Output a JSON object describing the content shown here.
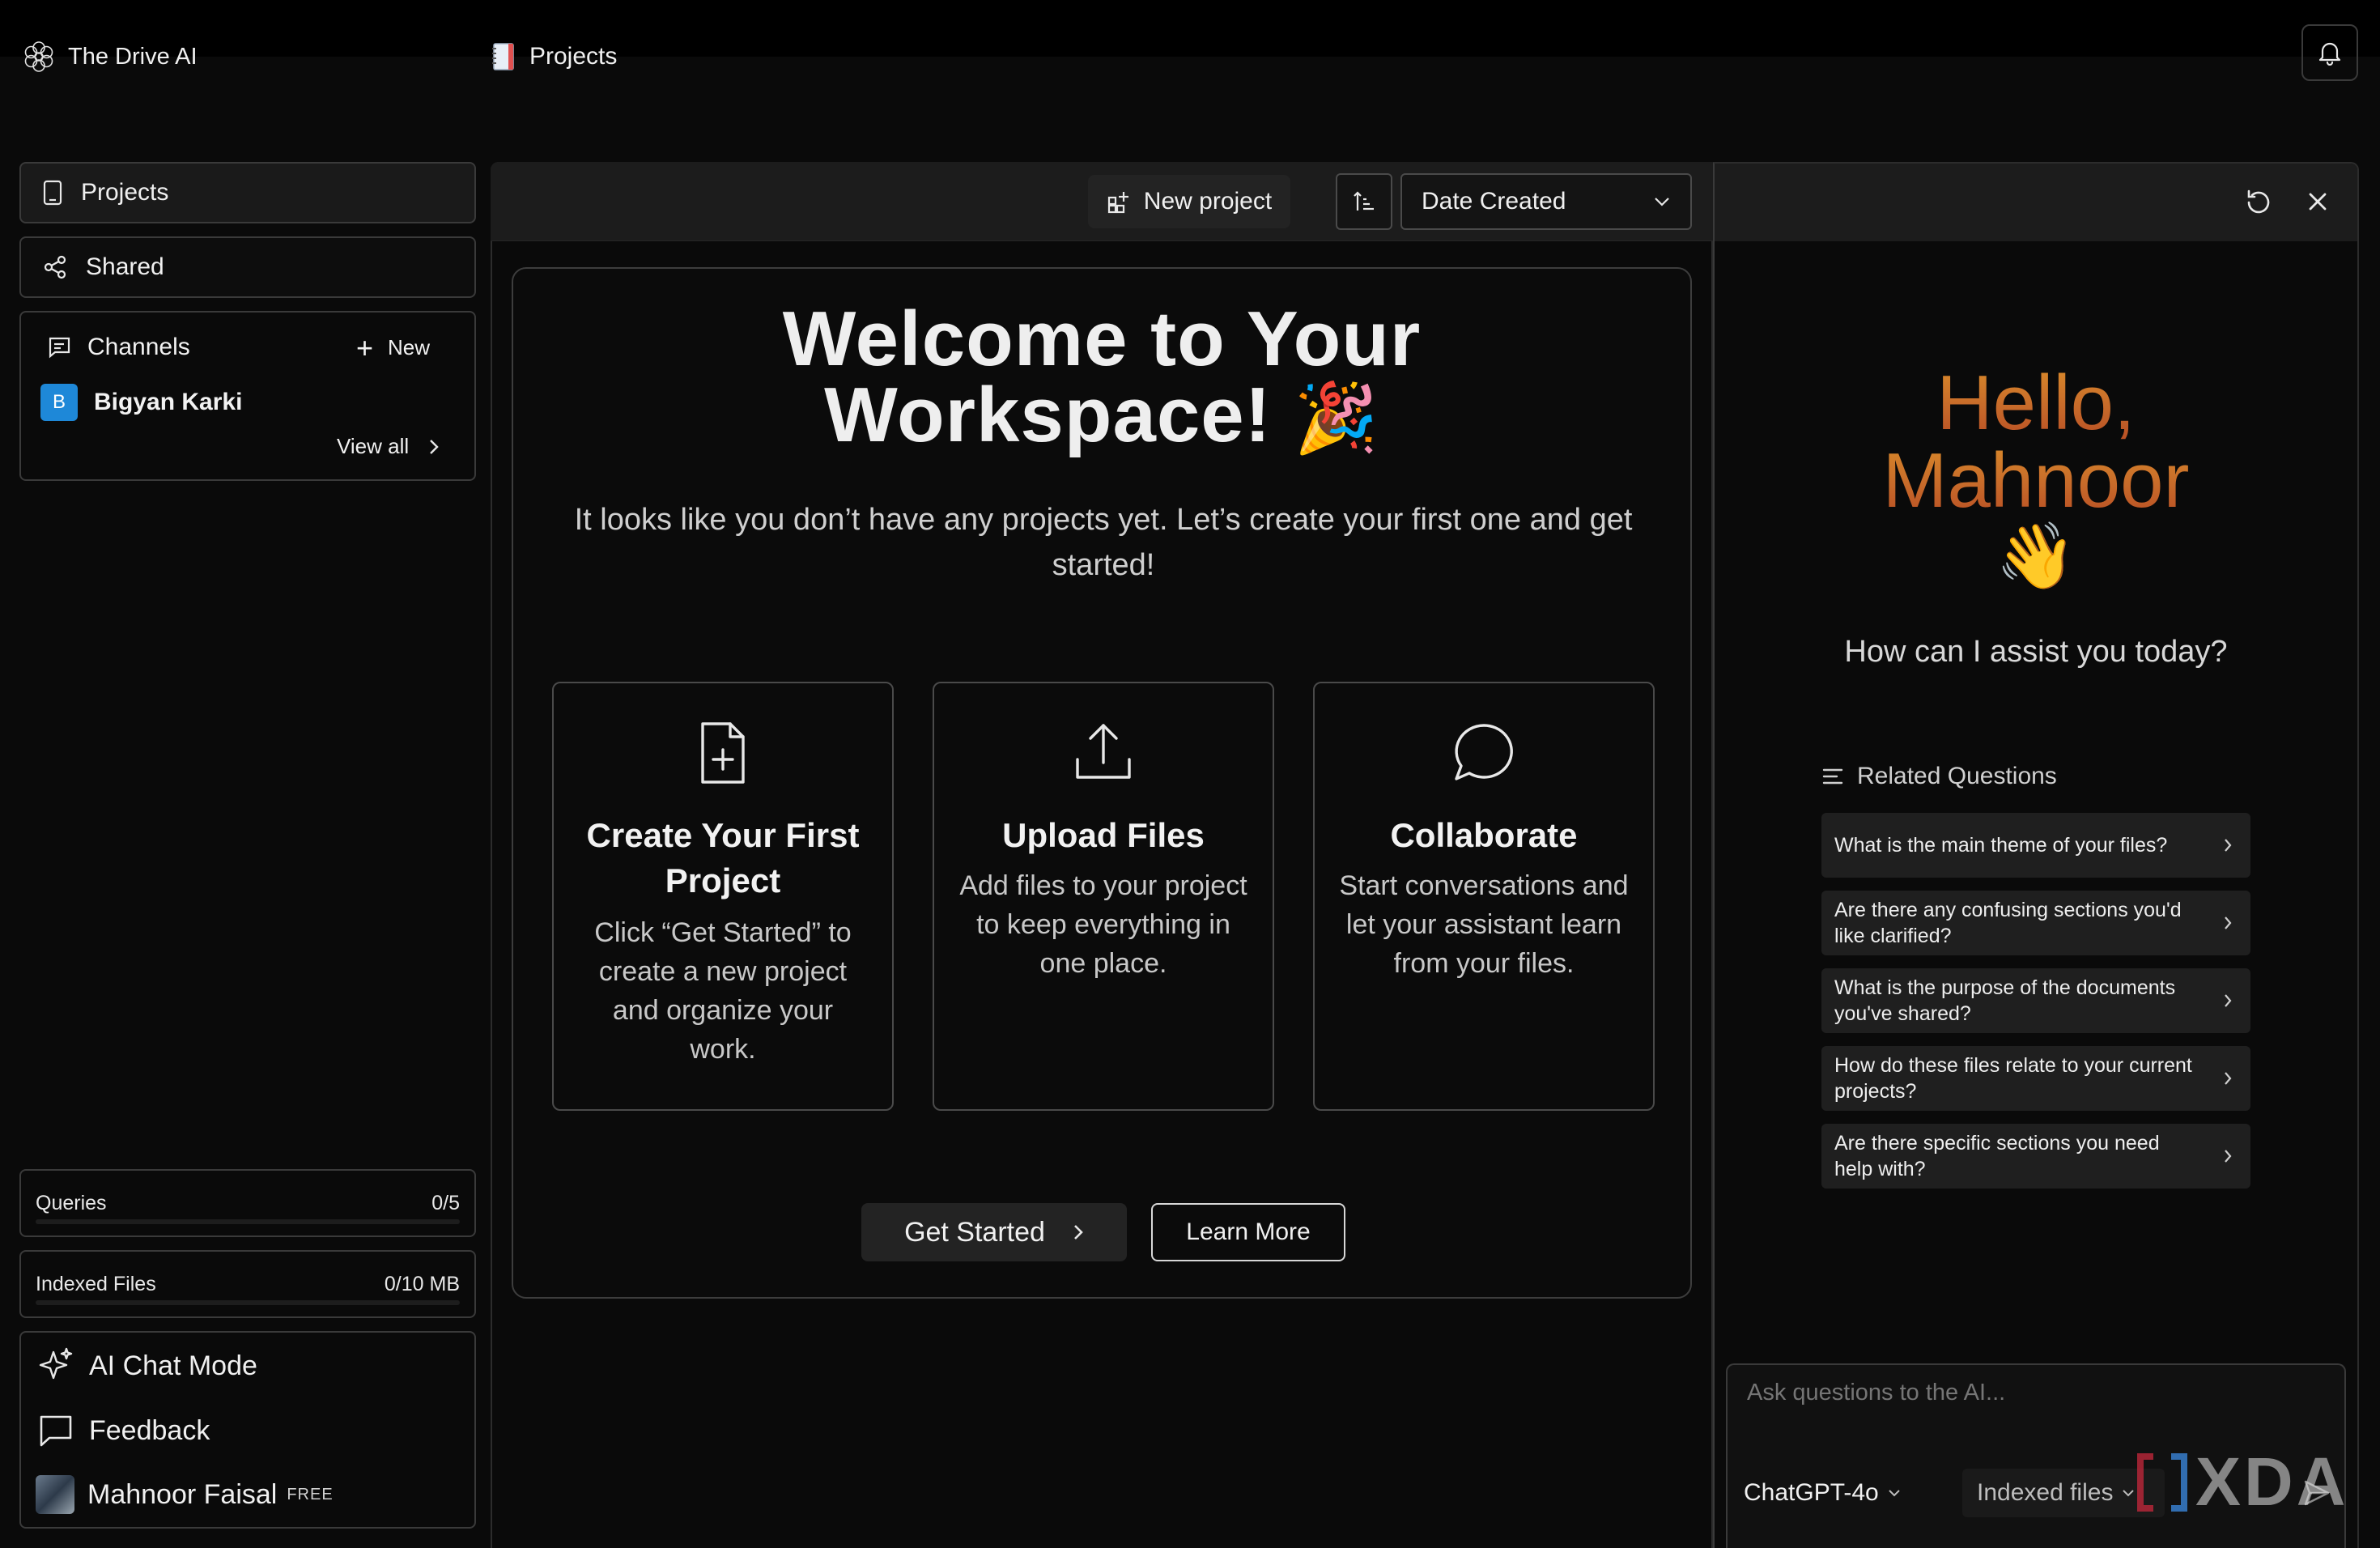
{
  "app": {
    "name": "The Drive AI"
  },
  "header": {
    "breadcrumb": "Projects"
  },
  "sidebar": {
    "projects_label": "Projects",
    "shared_label": "Shared",
    "channels": {
      "title": "Channels",
      "new_label": "New",
      "items": [
        {
          "initial": "B",
          "name": "Bigyan Karki"
        }
      ],
      "view_all": "View all"
    },
    "queries": {
      "label": "Queries",
      "value": "0/5"
    },
    "indexed_files": {
      "label": "Indexed Files",
      "value": "0/10 MB"
    },
    "ai_chat_mode": "AI Chat Mode",
    "feedback": "Feedback",
    "user": {
      "name": "Mahnoor Faisal",
      "plan": "FREE"
    }
  },
  "toolbar": {
    "new_project": "New project",
    "sort_select": "Date Created"
  },
  "welcome": {
    "title_line1": "Welcome to Your",
    "title_line2": "Workspace!",
    "emoji": "🎉",
    "subtitle": "It looks like you don’t have any projects yet. Let’s create your first one and get started!",
    "cards": [
      {
        "title": "Create Your First Project",
        "desc": "Click “Get Started” to create a new project and organize your work."
      },
      {
        "title": "Upload Files",
        "desc": "Add files to your project to keep everything in one place."
      },
      {
        "title": "Collaborate",
        "desc": "Start conversations and let your assistant learn from your files."
      }
    ],
    "get_started": "Get Started",
    "learn_more": "Learn More"
  },
  "assistant": {
    "hello_line1": "Hello,",
    "hello_line2": "Mahnoor",
    "wave": "👋",
    "question": "How can I assist you today?",
    "related_title": "Related Questions",
    "related": [
      "What is the main theme of your files?",
      "Are there any confusing sections you'd like clarified?",
      "What is the purpose of the documents you've shared?",
      "How do these files relate to your current projects?",
      "Are there specific sections you need help with?"
    ],
    "input_placeholder": "Ask questions to the AI...",
    "model": "ChatGPT-4o",
    "source": "Indexed files"
  },
  "watermark": "XDA",
  "colors": {
    "accent_gradient_start": "#d98a2a",
    "accent_gradient_end": "#b84e24",
    "channel_avatar": "#1e88d8"
  }
}
